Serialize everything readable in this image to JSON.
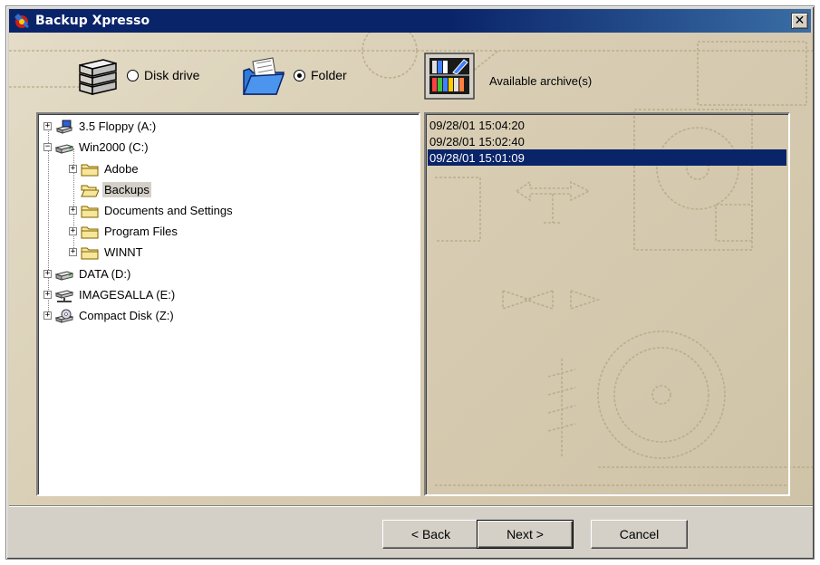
{
  "window": {
    "title": "Backup Xpresso"
  },
  "source": {
    "disk_drive_label": "Disk drive",
    "folder_label": "Folder",
    "selected": "Folder"
  },
  "archives": {
    "label": "Available archive(s)",
    "items": [
      "09/28/01 15:04:20",
      "09/28/01 15:02:40",
      "09/28/01 15:01:09"
    ],
    "selected_index": 2
  },
  "tree": {
    "items": [
      {
        "label": "3.5 Floppy (A:)",
        "icon": "floppy-drive-icon"
      },
      {
        "label": "Win2000 (C:)",
        "icon": "hard-drive-icon"
      },
      {
        "label": "Adobe",
        "icon": "folder-icon"
      },
      {
        "label": "Backups",
        "icon": "folder-open-icon"
      },
      {
        "label": "Documents and Settings",
        "icon": "folder-icon"
      },
      {
        "label": "Program Files",
        "icon": "folder-icon"
      },
      {
        "label": "WINNT",
        "icon": "folder-icon"
      },
      {
        "label": "DATA (D:)",
        "icon": "hard-drive-icon"
      },
      {
        "label": "IMAGESALLA (E:)",
        "icon": "network-drive-icon"
      },
      {
        "label": "Compact Disk (Z:)",
        "icon": "cd-drive-icon"
      }
    ],
    "selected": "Backups"
  },
  "buttons": {
    "back": "< Back",
    "next": "Next >",
    "cancel": "Cancel"
  },
  "colors": {
    "title_bar": "#0a246a",
    "selection": "#0a246a",
    "dialog_face": "#d4d0c8",
    "background_art": "#d8cdb3"
  }
}
